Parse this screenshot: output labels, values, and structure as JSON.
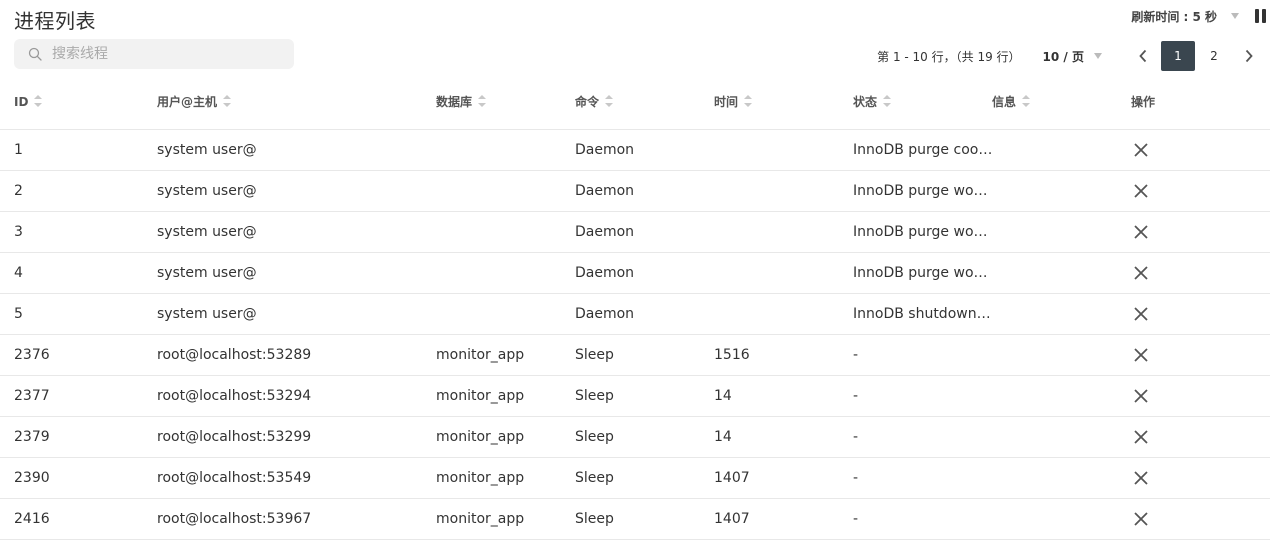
{
  "header": {
    "title": "进程列表",
    "refresh_label": "刷新时间 : 5 秒"
  },
  "search": {
    "placeholder": "搜索线程",
    "value": ""
  },
  "pagination": {
    "range_text": "第 1 - 10 行，（共 19 行）",
    "page_size": "10 / 页",
    "pages": [
      "1",
      "2"
    ],
    "current_page": "1"
  },
  "columns": {
    "id": "ID",
    "user": "用户@主机",
    "db": "数据库",
    "command": "命令",
    "time": "时间",
    "state": "状态",
    "info": "信息",
    "actions": "操作"
  },
  "rows": [
    {
      "id": "1",
      "user": "system user@",
      "db": "",
      "command": "Daemon",
      "time": "",
      "state": "InnoDB purge coor...",
      "info": ""
    },
    {
      "id": "2",
      "user": "system user@",
      "db": "",
      "command": "Daemon",
      "time": "",
      "state": "InnoDB purge work...",
      "info": ""
    },
    {
      "id": "3",
      "user": "system user@",
      "db": "",
      "command": "Daemon",
      "time": "",
      "state": "InnoDB purge work...",
      "info": ""
    },
    {
      "id": "4",
      "user": "system user@",
      "db": "",
      "command": "Daemon",
      "time": "",
      "state": "InnoDB purge work...",
      "info": ""
    },
    {
      "id": "5",
      "user": "system user@",
      "db": "",
      "command": "Daemon",
      "time": "",
      "state": "InnoDB shutdown ...",
      "info": ""
    },
    {
      "id": "2376",
      "user": "root@localhost:53289",
      "db": "monitor_app",
      "command": "Sleep",
      "time": "1516",
      "state": "-",
      "info": ""
    },
    {
      "id": "2377",
      "user": "root@localhost:53294",
      "db": "monitor_app",
      "command": "Sleep",
      "time": "14",
      "state": "-",
      "info": ""
    },
    {
      "id": "2379",
      "user": "root@localhost:53299",
      "db": "monitor_app",
      "command": "Sleep",
      "time": "14",
      "state": "-",
      "info": ""
    },
    {
      "id": "2390",
      "user": "root@localhost:53549",
      "db": "monitor_app",
      "command": "Sleep",
      "time": "1407",
      "state": "-",
      "info": ""
    },
    {
      "id": "2416",
      "user": "root@localhost:53967",
      "db": "monitor_app",
      "command": "Sleep",
      "time": "1407",
      "state": "-",
      "info": ""
    }
  ],
  "colors": {
    "active_page_bg": "#3a464f",
    "text": "#333333",
    "divider": "#e8e8e8"
  }
}
